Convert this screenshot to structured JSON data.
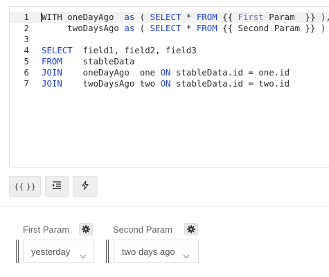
{
  "editor": {
    "lines": [
      {
        "n": "1",
        "parts": [
          [
            "t",
            "WITH oneDayAgo  "
          ],
          [
            "k",
            "as"
          ],
          [
            "t",
            " ( "
          ],
          [
            "k",
            "SELECT"
          ],
          [
            "t",
            " * "
          ],
          [
            "k",
            "FROM"
          ],
          [
            "t",
            " {{ "
          ],
          [
            "p",
            "First"
          ],
          [
            "t",
            " Param  }} ),"
          ]
        ]
      },
      {
        "n": "2",
        "parts": [
          [
            "t",
            "     twoDaysAgo "
          ],
          [
            "k",
            "as"
          ],
          [
            "t",
            " ( "
          ],
          [
            "k",
            "SELECT"
          ],
          [
            "t",
            " * "
          ],
          [
            "k",
            "FROM"
          ],
          [
            "t",
            " {{ Second Param }} )"
          ]
        ]
      },
      {
        "n": "3",
        "parts": []
      },
      {
        "n": "4",
        "parts": [
          [
            "k",
            "SELECT"
          ],
          [
            "t",
            "  field1, field2, field3"
          ]
        ]
      },
      {
        "n": "5",
        "parts": [
          [
            "k",
            "FROM"
          ],
          [
            "t",
            "    stableData"
          ]
        ]
      },
      {
        "n": "6",
        "parts": [
          [
            "k",
            "JOIN"
          ],
          [
            "t",
            "    oneDayAgo  one "
          ],
          [
            "k",
            "ON"
          ],
          [
            "t",
            " stableData.id = one.id"
          ]
        ]
      },
      {
        "n": "7",
        "parts": [
          [
            "k",
            "JOIN"
          ],
          [
            "t",
            "    twoDaysAgo two "
          ],
          [
            "k",
            "ON"
          ],
          [
            "t",
            " stableData.id = two.id"
          ]
        ]
      }
    ]
  },
  "toolbar": {
    "params_label": "{{ }}",
    "format_icon": "indent-icon",
    "run_icon": "lightning-bolt-icon"
  },
  "params": [
    {
      "label": "First Param",
      "value": "yesterday"
    },
    {
      "label": "Second Param",
      "value": "two days ago"
    }
  ],
  "colors": {
    "keyword": "#1f3fd1",
    "placeholder": "#6a6fb4",
    "active_line": "#f2f2f2"
  }
}
